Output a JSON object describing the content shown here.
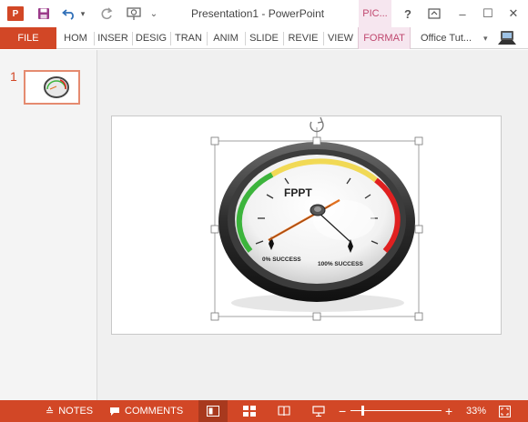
{
  "titlebar": {
    "app_icon": "P",
    "title": "Presentation1 - PowerPoint",
    "context_tab": "PIC...",
    "help": "?",
    "minimize": "–",
    "maximize": "☐",
    "close": "✕",
    "undo_caret": "▾",
    "customize_caret": "⌄"
  },
  "ribbon": {
    "file": "FILE",
    "tabs": [
      "HOM",
      "INSER",
      "DESIG",
      "TRAN",
      "ANIM",
      "SLIDE",
      "REVIE",
      "VIEW",
      "FORMAT"
    ],
    "user": "Office Tut...",
    "user_caret": "▾"
  },
  "thumbnails": {
    "slide_number": "1"
  },
  "gauge": {
    "title": "FPPT",
    "left_label": "0% SUCCESS",
    "right_label": "100% SUCCESS",
    "colors": {
      "green": "#3cb43c",
      "yellow": "#f0d020",
      "red": "#e02020",
      "needle": "#e07020"
    }
  },
  "statusbar": {
    "notes": "NOTES",
    "comments": "COMMENTS",
    "zoom_out": "−",
    "zoom_in": "+",
    "zoom": "33%",
    "zoom_fraction": 0.33,
    "accent": "#d24726"
  }
}
